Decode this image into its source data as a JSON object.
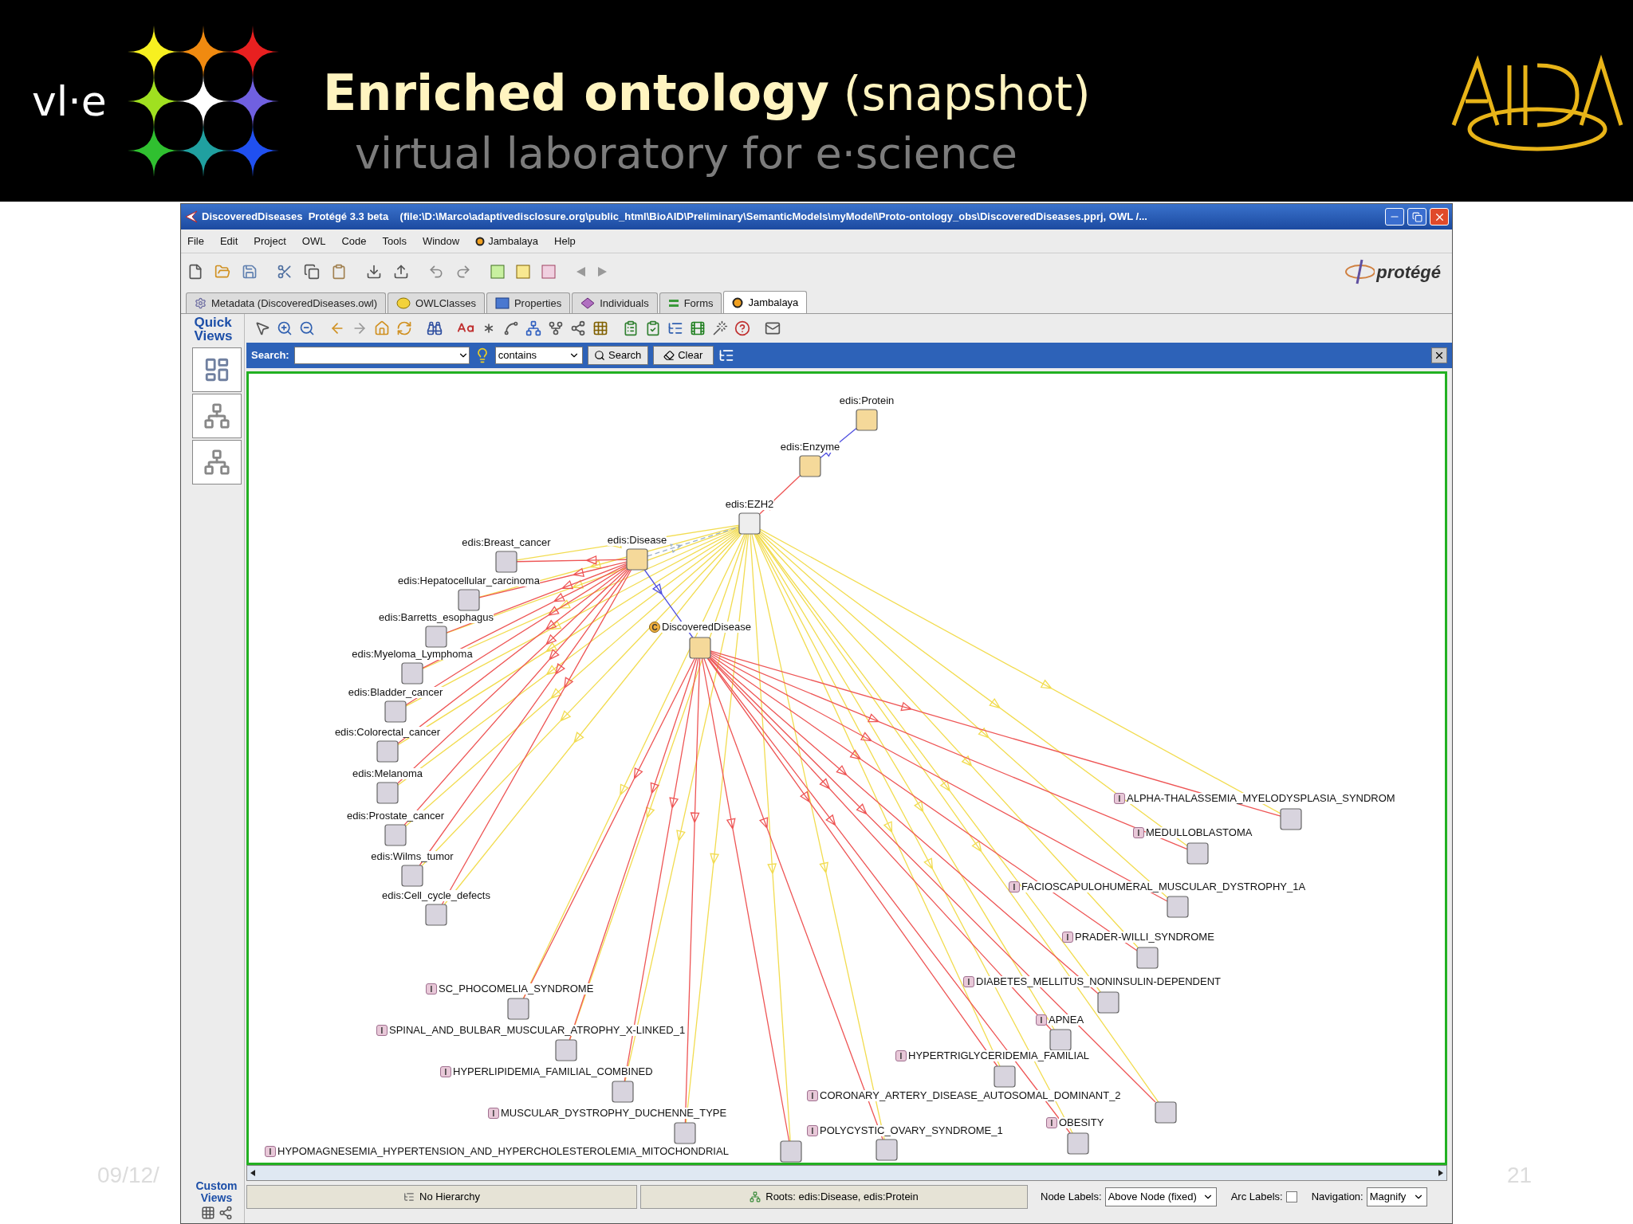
{
  "slide": {
    "brand": "vl·e",
    "title": "Enriched ontology",
    "title_note": "(snapshot)",
    "subtitle": "virtual laboratory for e·science",
    "date": "09/12/",
    "page_number": "21"
  },
  "window": {
    "title": "DiscoveredDiseases  Protégé 3.3 beta    (file:\\D:\\Marco\\adaptivedisclosure.org\\public_html\\BioAID\\Preliminary\\SemanticModels\\myModel\\Proto-ontology_obs\\DiscoveredDiseases.pprj, OWL /...",
    "logo": "protégé"
  },
  "menu": [
    {
      "label": "File",
      "kind": "plain"
    },
    {
      "label": "Edit",
      "kind": "plain"
    },
    {
      "label": "Project",
      "kind": "plain"
    },
    {
      "label": "OWL",
      "kind": "plain"
    },
    {
      "label": "Code",
      "kind": "plain"
    },
    {
      "label": "Tools",
      "kind": "plain"
    },
    {
      "label": "Window",
      "kind": "plain"
    },
    {
      "label": "Jambalaya",
      "kind": "icon"
    },
    {
      "label": "Help",
      "kind": "plain"
    }
  ],
  "tabs": [
    {
      "label": "Metadata (DiscoveredDiseases.owl)",
      "selected": false
    },
    {
      "label": "OWLClasses",
      "selected": false
    },
    {
      "label": "Properties",
      "selected": false
    },
    {
      "label": "Individuals",
      "selected": false
    },
    {
      "label": "Forms",
      "selected": false
    },
    {
      "label": "Jambalaya",
      "selected": true
    }
  ],
  "quick_views": {
    "title": "Quick Views",
    "custom": "Custom Views"
  },
  "search": {
    "label": "Search:",
    "mode": "contains",
    "buttons": [
      "Search",
      "Clear"
    ]
  },
  "graph": {
    "nodes": [
      {
        "label": "edis:Protein",
        "kind": "class",
        "selected": false
      },
      {
        "label": "edis:Enzyme",
        "kind": "class",
        "selected": false
      },
      {
        "label": "edis:EZH2",
        "kind": "individual",
        "selected": true
      },
      {
        "label": "edis:Disease",
        "kind": "class",
        "selected": false
      },
      {
        "label": "edis:Breast_cancer",
        "kind": "individual",
        "selected": false
      },
      {
        "label": "edis:Hepatocellular_carcinoma",
        "kind": "individual",
        "selected": false
      },
      {
        "label": "edis:Barretts_esophagus",
        "kind": "individual",
        "selected": false
      },
      {
        "label": "edis:Myeloma_Lymphoma",
        "kind": "individual",
        "selected": false
      },
      {
        "label": "edis:Bladder_cancer",
        "kind": "individual",
        "selected": false
      },
      {
        "label": "edis:Colorectal_cancer",
        "kind": "individual",
        "selected": false
      },
      {
        "label": "edis:Melanoma",
        "kind": "individual",
        "selected": false
      },
      {
        "label": "edis:Prostate_cancer",
        "kind": "individual",
        "selected": false
      },
      {
        "label": "edis:Wilms_tumor",
        "kind": "individual",
        "selected": false
      },
      {
        "label": "edis:Cell_cycle_defects",
        "kind": "individual",
        "selected": false
      },
      {
        "label": "DiscoveredDisease",
        "kind": "class",
        "badge": "C",
        "selected": false
      },
      {
        "label": "ALPHA-THALASSEMIA_MYELODYSPLASIA_SYNDROM",
        "kind": "individual",
        "badge": "I",
        "selected": false
      },
      {
        "label": "MEDULLOBLASTOMA",
        "kind": "individual",
        "badge": "I",
        "selected": false
      },
      {
        "label": "FACIOSCAPULOHUMERAL_MUSCULAR_DYSTROPHY_1A",
        "kind": "individual",
        "badge": "I",
        "selected": false
      },
      {
        "label": "PRADER-WILLI_SYNDROME",
        "kind": "individual",
        "badge": "I",
        "selected": false
      },
      {
        "label": "DIABETES_MELLITUS_NONINSULIN-DEPENDENT",
        "kind": "individual",
        "badge": "I",
        "selected": false
      },
      {
        "label": "SC_PHOCOMELIA_SYNDROME",
        "kind": "individual",
        "badge": "I",
        "selected": false
      },
      {
        "label": "APNEA",
        "kind": "individual",
        "badge": "I",
        "selected": false
      },
      {
        "label": "SPINAL_AND_BULBAR_MUSCULAR_ATROPHY_X-LINKED_1",
        "kind": "individual",
        "badge": "I",
        "selected": false
      },
      {
        "label": "HYPERTRIGLYCERIDEMIA_FAMILIAL",
        "kind": "individual",
        "badge": "I",
        "selected": false
      },
      {
        "label": "HYPERLIPIDEMIA_FAMILIAL_COMBINED",
        "kind": "individual",
        "badge": "I",
        "selected": false
      },
      {
        "label": "CORONARY_ARTERY_DISEASE_AUTOSOMAL_DOMINANT_2",
        "kind": "individual",
        "badge": "I",
        "selected": false
      },
      {
        "label": "MUSCULAR_DYSTROPHY_DUCHENNE_TYPE",
        "kind": "individual",
        "badge": "I",
        "selected": false
      },
      {
        "label": "OBESITY",
        "kind": "individual",
        "badge": "I",
        "selected": false
      },
      {
        "label": "POLYCYSTIC_OVARY_SYNDROME_1",
        "kind": "individual",
        "badge": "I",
        "selected": false
      },
      {
        "label": "HYPOMAGNESEMIA_HYPERTENSION_AND_HYPERCHOLESTEROLEMIA_MITOCHONDRIAL",
        "kind": "individual",
        "badge": "I",
        "selected": false
      }
    ]
  },
  "status_bar": {
    "hierarchy": "No Hierarchy",
    "roots": "Roots: edis:Disease, edis:Protein",
    "node_labels_label": "Node Labels:",
    "node_labels": "Above Node (fixed)",
    "arc_labels_label": "Arc Labels:",
    "arc_labels_checked": false,
    "navigation_label": "Navigation:",
    "navigation": "Magnify"
  }
}
